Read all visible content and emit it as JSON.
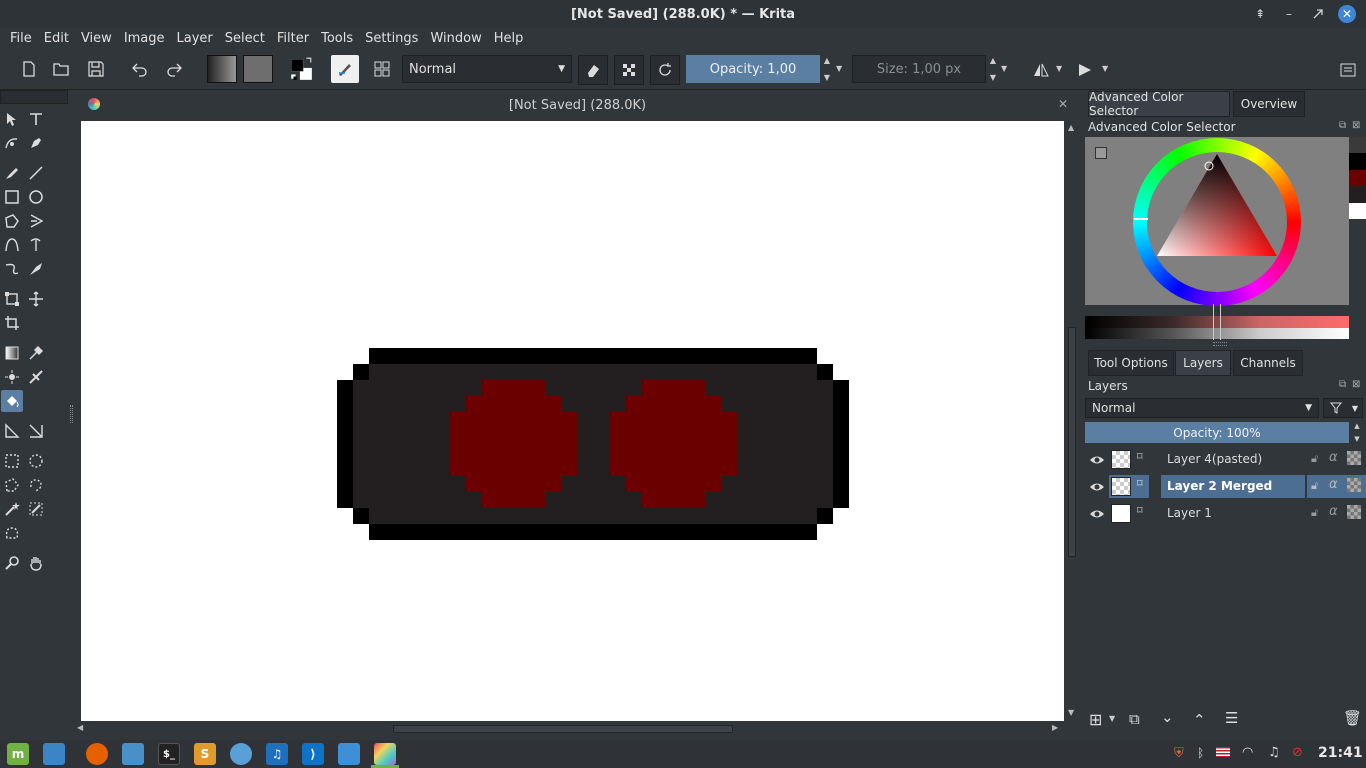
{
  "window": {
    "title": "[Not Saved]  (288.0K) * — Krita"
  },
  "menu": [
    "File",
    "Edit",
    "View",
    "Image",
    "Layer",
    "Select",
    "Filter",
    "Tools",
    "Settings",
    "Window",
    "Help"
  ],
  "toolbar": {
    "blend_mode": "Normal",
    "opacity_label": "Opacity:  1,00",
    "opacity_value": 1.0,
    "size_label": "Size:  1,00 px"
  },
  "document": {
    "tab_title": "[Not Saved]  (288.0K)"
  },
  "dock": {
    "tabs_top": [
      "Advanced Color Selector",
      "Overview"
    ],
    "color_selector_title": "Advanced Color Selector",
    "tabs_bottom": [
      "Tool Options",
      "Layers",
      "Channels"
    ],
    "layers_title": "Layers",
    "layer_blend_mode": "Normal",
    "layer_opacity_label": "Opacity:  100%",
    "layer_opacity_value": 1.0,
    "layers": [
      {
        "name": "Layer 4(pasted)",
        "selected": false
      },
      {
        "name": "Layer 2 Merged",
        "selected": true
      },
      {
        "name": "Layer 1",
        "selected": false
      }
    ]
  },
  "colors": {
    "accent": "#5b7fa3",
    "selection": "#4c6e93",
    "goggle_frame": "#000000",
    "goggle_body": "#231f20",
    "goggle_lens": "#6b0000"
  },
  "taskbar": {
    "clock": "21:41"
  }
}
